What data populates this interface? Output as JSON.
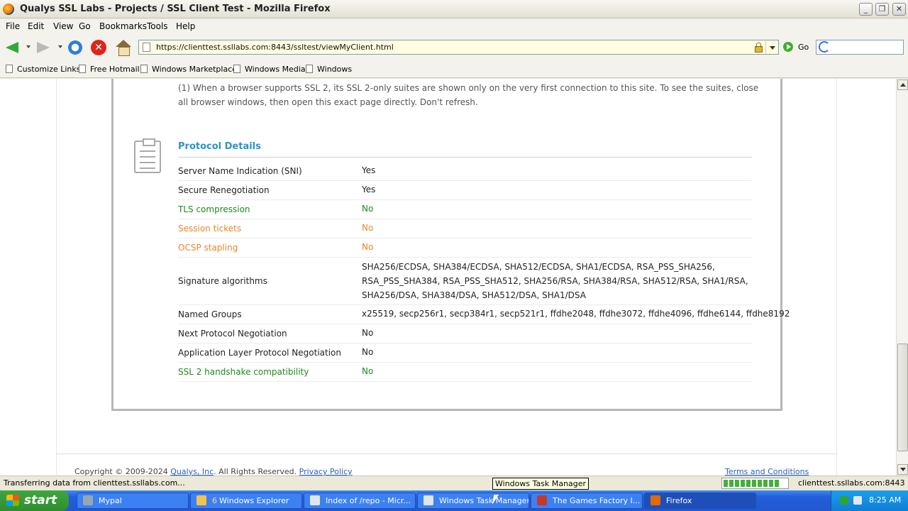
{
  "window": {
    "title": "Qualys SSL Labs - Projects / SSL Client Test - Mozilla Firefox"
  },
  "menu": [
    "File",
    "Edit",
    "View",
    "Go",
    "Bookmarks",
    "Tools",
    "Help"
  ],
  "nav": {
    "url": "https://clienttest.ssllabs.com:8443/ssltest/viewMyClient.html",
    "go_label": "Go"
  },
  "bookmarks": [
    "Customize Links",
    "Free Hotmail",
    "Windows Marketplace",
    "Windows Media",
    "Windows"
  ],
  "page": {
    "note": "(1) When a browser supports SSL 2, its SSL 2-only suites are shown only on the very first connection to this site. To see the suites, close all browser windows, then open this exact page directly. Don't refresh.",
    "section_title": "Protocol Details",
    "rows": [
      {
        "label": "Server Name Indication (SNI)",
        "value": "Yes",
        "color": "#222222"
      },
      {
        "label": "Secure Renegotiation",
        "value": "Yes",
        "color": "#222222"
      },
      {
        "label": "TLS compression",
        "value": "No",
        "color": "#1e8a1e"
      },
      {
        "label": "Session tickets",
        "value": "No",
        "color": "#e8862a"
      },
      {
        "label": "OCSP stapling",
        "value": "No",
        "color": "#e8862a"
      },
      {
        "label": "Signature algorithms",
        "value": "SHA256/ECDSA, SHA384/ECDSA, SHA512/ECDSA, SHA1/ECDSA, RSA_PSS_SHA256, RSA_PSS_SHA384, RSA_PSS_SHA512, SHA256/RSA, SHA384/RSA, SHA512/RSA, SHA1/RSA, SHA256/DSA, SHA384/DSA, SHA512/DSA, SHA1/DSA",
        "color": "#222222"
      },
      {
        "label": "Named Groups",
        "value": "x25519, secp256r1, secp384r1, secp521r1, ffdhe2048, ffdhe3072, ffdhe4096, ffdhe6144, ffdhe8192",
        "color": "#222222"
      },
      {
        "label": "Next Protocol Negotiation",
        "value": "No",
        "color": "#222222"
      },
      {
        "label": "Application Layer Protocol Negotiation",
        "value": "No",
        "color": "#222222"
      },
      {
        "label": "SSL 2 handshake compatibility",
        "value": "No",
        "color": "#1e8a1e"
      }
    ],
    "footer": {
      "copyright": "Copyright © 2009-2024",
      "company_link": "Qualys, Inc",
      "rights": ". All Rights Reserved.",
      "privacy_link": "Privacy Policy",
      "terms_link": "Terms and Conditions"
    }
  },
  "status": {
    "text": "Transferring data from clienttest.ssllabs.com...",
    "host": "clienttest.ssllabs.com:8443",
    "progress": 0.9
  },
  "tooltip": "Windows Task Manager",
  "taskbar": {
    "start_label": "start",
    "tasks": [
      {
        "label": "Mypal",
        "count": ""
      },
      {
        "label": "Windows Explorer",
        "count": "6"
      },
      {
        "label": "Index of /repo - Micr...",
        "count": ""
      },
      {
        "label": "Windows Task Manager",
        "count": ""
      },
      {
        "label": "The Games Factory I...",
        "count": ""
      },
      {
        "label": "Firefox",
        "count": ""
      }
    ],
    "clock": "8:25 AM"
  }
}
